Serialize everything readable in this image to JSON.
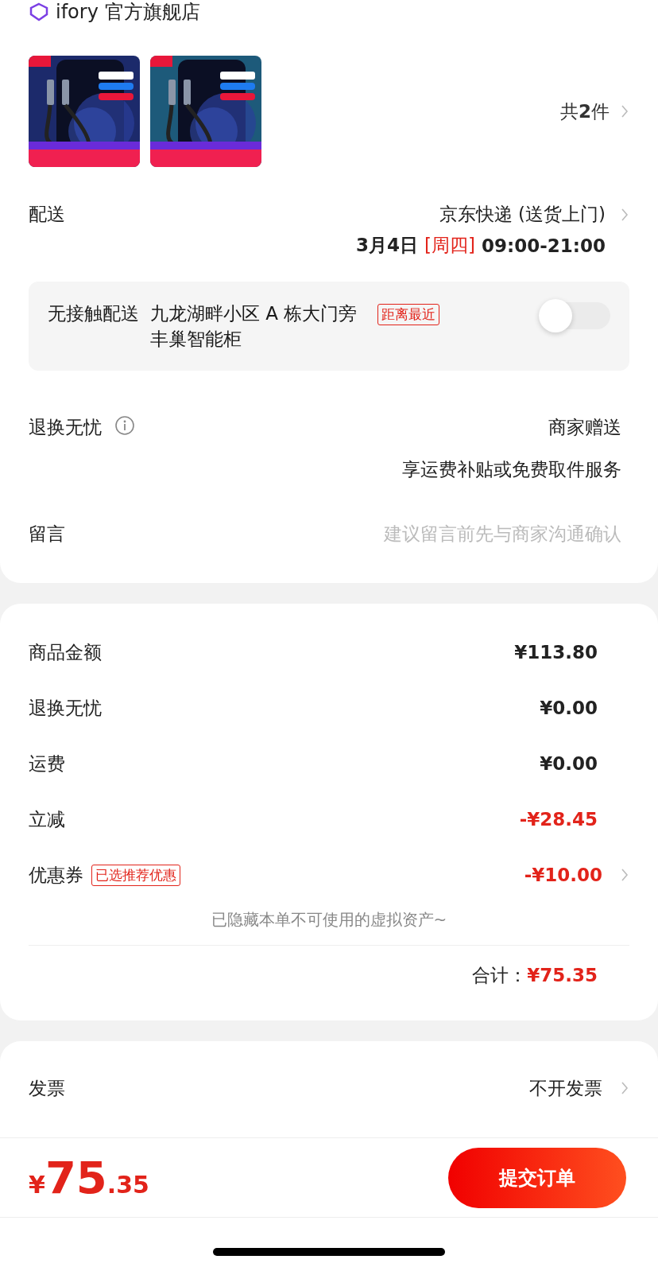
{
  "store": {
    "name": "ifory 官方旗舰店"
  },
  "products": {
    "count_prefix": "共",
    "count": "2",
    "count_suffix": "件"
  },
  "delivery": {
    "label": "配送",
    "carrier": "京东快递 (送货上门)",
    "date": "3月4日",
    "weekday": "[周四]",
    "time": "09:00-21:00"
  },
  "contactless": {
    "label": "无接触配送",
    "address": "九龙湖畔小区 A 栋大门旁丰巢智能柜",
    "tag": "距离最近",
    "on": false
  },
  "returns": {
    "label": "退换无忧",
    "value": "商家赠送",
    "detail": "享运费补贴或免费取件服务"
  },
  "message": {
    "label": "留言",
    "placeholder": "建议留言前先与商家沟通确认"
  },
  "summary": {
    "rows": [
      {
        "label": "商品金额",
        "value": "¥113.80",
        "discount": false,
        "arrow": false
      },
      {
        "label": "退换无忧",
        "value": "¥0.00",
        "discount": false,
        "arrow": false
      },
      {
        "label": "运费",
        "value": "¥0.00",
        "discount": false,
        "arrow": false
      },
      {
        "label": "立减",
        "value": "-¥28.45",
        "discount": true,
        "arrow": false
      },
      {
        "label": "优惠券",
        "tag": "已选推荐优惠",
        "value": "-¥10.00",
        "discount": true,
        "arrow": true
      }
    ],
    "hidden_note": "已隐藏本单不可使用的虚拟资产~",
    "total_label": "合计：",
    "total": "¥75.35"
  },
  "extra": [
    {
      "label": "发票",
      "value": "不开发票"
    }
  ],
  "bottom_bar": {
    "currency": "¥",
    "price_int": "75",
    "price_dec": ".35",
    "submit": "提交订单"
  }
}
